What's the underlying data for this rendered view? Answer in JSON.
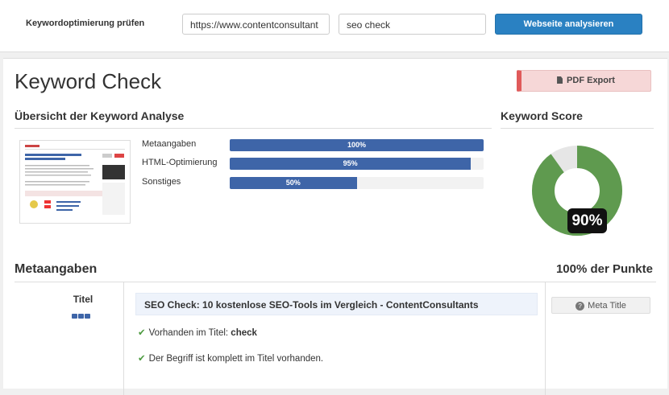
{
  "topbar": {
    "label": "Keywordoptimierung prüfen",
    "url_value": "https://www.contentconsultant",
    "keyword_value": "seo check",
    "analyze_label": "Webseite analysieren"
  },
  "main": {
    "title": "Keyword Check",
    "pdf_label": "PDF Export",
    "overview_heading": "Übersicht der Keyword Analyse",
    "score_heading": "Keyword Score",
    "score_value": "90%",
    "score_fraction": 0.9,
    "bars": [
      {
        "label": "Metaangaben",
        "value_text": "100%",
        "value": 100
      },
      {
        "label": "HTML-Optimierung",
        "value_text": "95%",
        "value": 95
      },
      {
        "label": "Sonstiges",
        "value_text": "50%",
        "value": 50
      }
    ]
  },
  "meta": {
    "heading": "Metaangaben",
    "points": "100% der Punkte",
    "row_label": "Titel",
    "title_text": "SEO Check: 10 kostenlose SEO-Tools im Vergleich - ContentConsultants",
    "check1_prefix": "Vorhanden im Titel: ",
    "check1_keyword": "check",
    "check2": "Der Begriff ist komplett im Titel vorhanden.",
    "meta_button": "Meta Title"
  },
  "colors": {
    "accent": "#2a81c2",
    "bar": "#3e65a8",
    "score_green": "#5f9a4f",
    "check": "#4c9a3f"
  }
}
